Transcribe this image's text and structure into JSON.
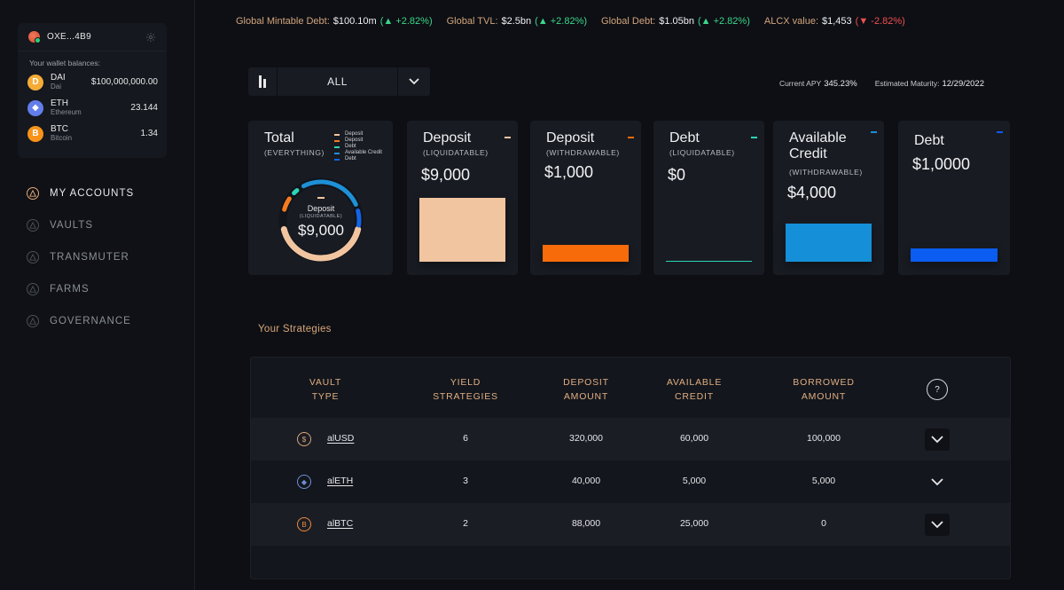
{
  "wallet": {
    "address": "OXE...4B9",
    "caption": "Your wallet balances:",
    "coins": [
      {
        "symbol": "DAI",
        "name": "Dai",
        "amount": "$100,000,000.00",
        "color": "#f5ac37",
        "glyph": "D"
      },
      {
        "symbol": "ETH",
        "name": "Ethereum",
        "amount": "23.144",
        "color": "#627eea",
        "glyph": "◆"
      },
      {
        "symbol": "BTC",
        "name": "Bitcoin",
        "amount": "1.34",
        "color": "#f7931a",
        "glyph": "B"
      }
    ]
  },
  "nav": [
    {
      "label": "MY ACCOUNTS",
      "icon": "accounts-icon",
      "active": true
    },
    {
      "label": "VAULTS",
      "icon": "vaults-icon"
    },
    {
      "label": "TRANSMUTER",
      "icon": "transmuter-icon"
    },
    {
      "label": "FARMS",
      "icon": "farms-icon"
    },
    {
      "label": "GOVERNANCE",
      "icon": "governance-icon"
    }
  ],
  "ticker": [
    {
      "label": "Global Mintable Debt:",
      "value": "$100.10m",
      "change": "(▲ +2.82%)",
      "dir": "up"
    },
    {
      "label": "Global TVL:",
      "value": "$2.5bn",
      "change": "(▲ +2.82%)",
      "dir": "up"
    },
    {
      "label": "Global Debt:",
      "value": "$1.05bn",
      "change": "(▲ +2.82%)",
      "dir": "up"
    },
    {
      "label": "ALCX value:",
      "value": "$1,453",
      "change": "(▼ -2.82%)",
      "dir": "down"
    }
  ],
  "filter": {
    "value": "ALL"
  },
  "apy": {
    "label": "Current APY",
    "value": "345.23%",
    "maturity_label": "Estimated Maturity:",
    "maturity_value": "12/29/2022"
  },
  "total_card": {
    "title": "Total",
    "subtitle": "(EVERYTHING)",
    "legend": [
      {
        "label": "Deposit",
        "color": "#f1c5a0"
      },
      {
        "label": "Deposit",
        "color": "#f47b20"
      },
      {
        "label": "Debt",
        "color": "#2dd4b7"
      },
      {
        "label": "Available Credit",
        "color": "#1e90d6"
      },
      {
        "label": "Debt",
        "color": "#1463e6"
      }
    ],
    "center_label": "Deposit",
    "center_sub": "(LIQUIDATABLE)",
    "center_value": "$9,000"
  },
  "cards": [
    {
      "title": "Deposit",
      "subtitle": "(LIQUIDATABLE)",
      "value": "$9,000",
      "color": "#f1c5a0",
      "level": 1.0
    },
    {
      "title": "Deposit",
      "subtitle": "(WITHDRAWABLE)",
      "value": "$1,000",
      "color": "#f76b0a",
      "level": 0.26
    },
    {
      "title": "Debt",
      "subtitle": "(LIQUIDATABLE)",
      "value": "$0",
      "color": "#2dd4b7",
      "level": 0.0
    },
    {
      "title": "Available Credit",
      "subtitle": "(WITHDRAWABLE)",
      "value": "$4,000",
      "color": "#1590d8",
      "level": 0.6
    },
    {
      "title": "Debt",
      "subtitle": "",
      "value": "$1,0000",
      "color": "#0b5cf0",
      "level": 0.21
    }
  ],
  "strategies": {
    "title": "Your Strategies",
    "headers": [
      "VAULT TYPE",
      "YIELD STRATEGIES",
      "DEPOSIT AMOUNT",
      "AVAILABLE CREDIT",
      "BORROWED AMOUNT"
    ],
    "help": "?",
    "rows": [
      {
        "vault": "alUSD",
        "icon": "usd-vault-icon",
        "icon_color": "#d9a67a",
        "glyph": "$",
        "strategies": "6",
        "deposit": "320,000",
        "credit": "60,000",
        "borrowed": "100,000"
      },
      {
        "vault": "alETH",
        "icon": "eth-vault-icon",
        "icon_color": "#6c8fd6",
        "glyph": "◆",
        "strategies": "3",
        "deposit": "40,000",
        "credit": "5,000",
        "borrowed": "5,000"
      },
      {
        "vault": "alBTC",
        "icon": "btc-vault-icon",
        "icon_color": "#f28a3c",
        "glyph": "B",
        "strategies": "2",
        "deposit": "88,000",
        "credit": "25,000",
        "borrowed": "0"
      }
    ]
  }
}
